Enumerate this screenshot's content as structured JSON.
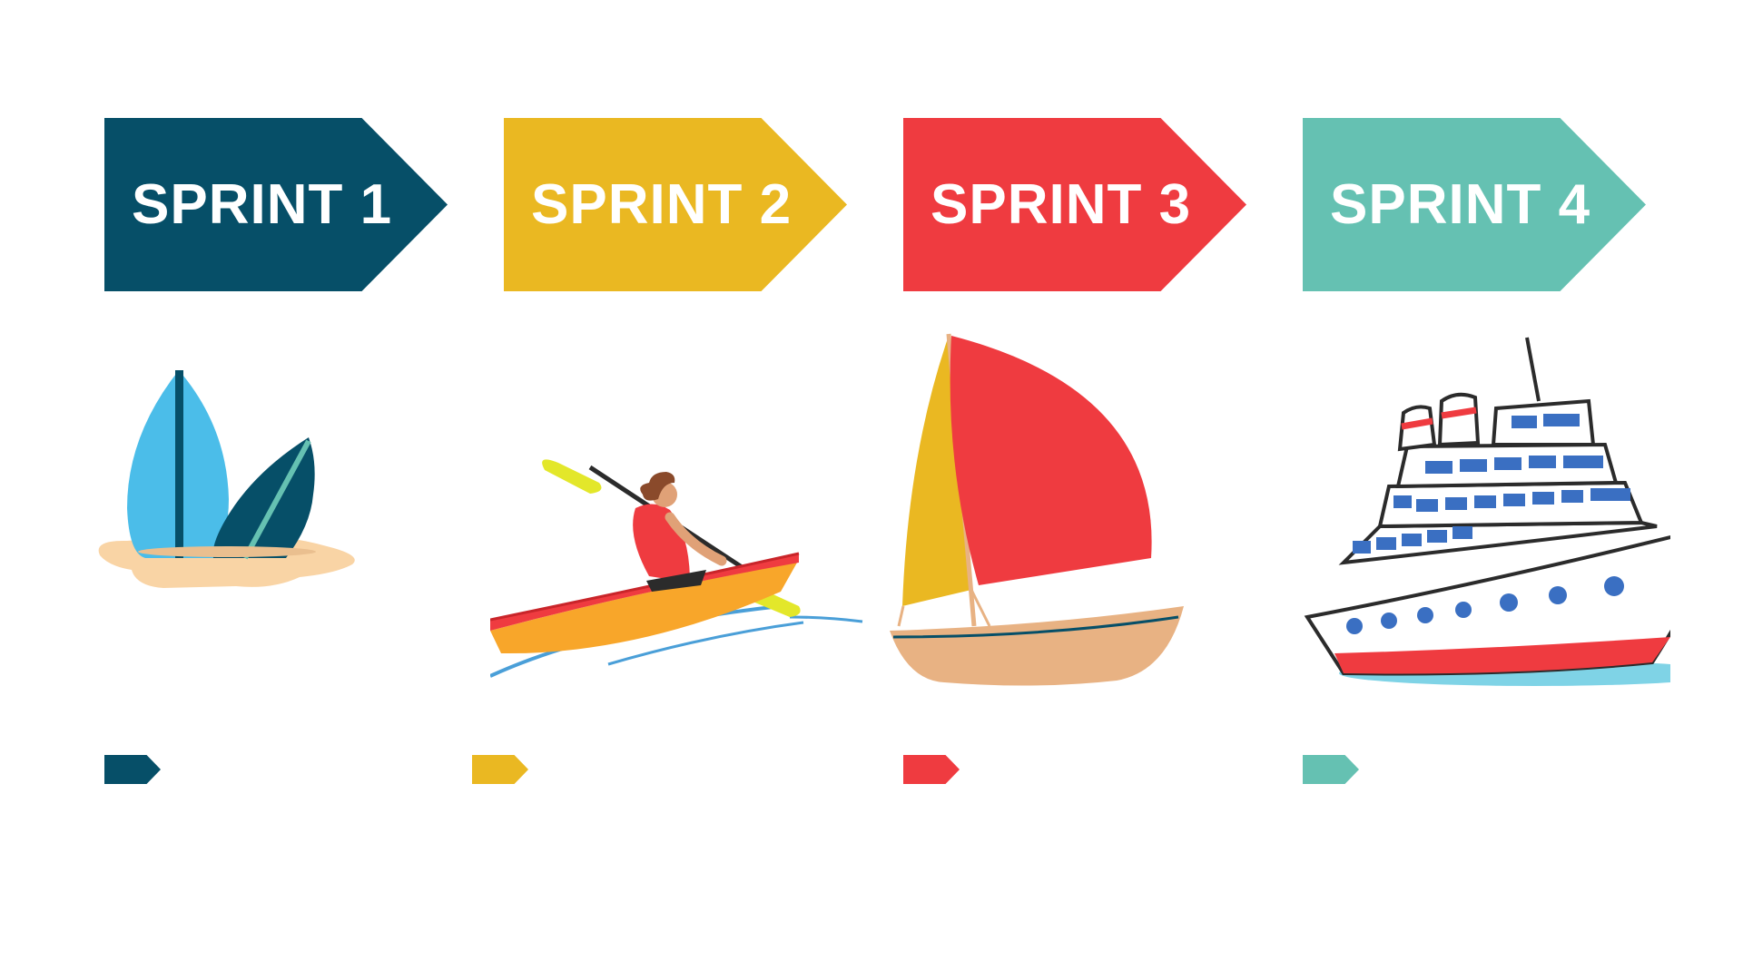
{
  "sprints": [
    {
      "label": "SPRINT 1",
      "color": "#064f68",
      "illustration": "surfboards-icon"
    },
    {
      "label": "SPRINT 2",
      "color": "#eab822",
      "illustration": "kayak-icon"
    },
    {
      "label": "SPRINT 3",
      "color": "#ef3b40",
      "illustration": "sailboat-icon"
    },
    {
      "label": "SPRINT 4",
      "color": "#65c1b2",
      "illustration": "cruise-ship-icon"
    }
  ]
}
